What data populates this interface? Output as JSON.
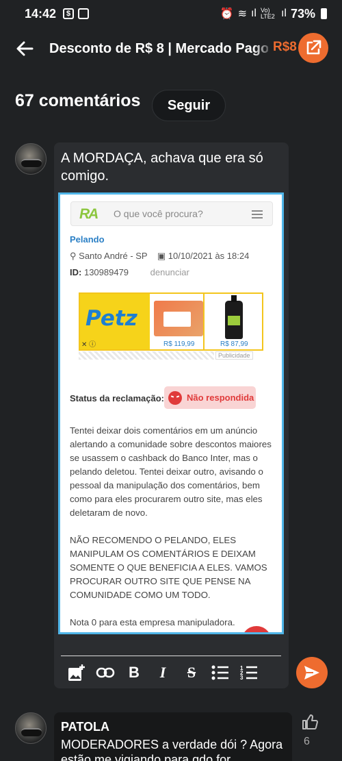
{
  "status_bar": {
    "time": "14:42",
    "network": "Vo) LTE2",
    "battery": "73%"
  },
  "app_bar": {
    "title": "Desconto de R$ 8 | Mercado Pago",
    "price": "R$8"
  },
  "comments_header": {
    "count": "67 comentários",
    "follow_label": "Seguir"
  },
  "compose": {
    "text": "A MORDAÇA, achava que era só comigo."
  },
  "screenshot": {
    "search_placeholder": "O que você procura?",
    "logo": "RA",
    "company": "Pelando",
    "location": "Santo André - SP",
    "datetime": "10/10/2021 às 18:24",
    "id_label": "ID:",
    "id_value": "130989479",
    "report_link": "denunciar",
    "ad": {
      "brand": "Petz",
      "price1": "R$ 119,99",
      "price2": "R$ 87,99",
      "label": "Publicidade"
    },
    "status_label": "Status da reclamação:",
    "status_value": "Não respondida",
    "paragraph1": "Tentei deixar dois comentários em um anúncio alertando a comunidade sobre descontos maiores se usassem o cashback do Banco Inter, mas o pelando deletou. Tentei deixar outro, avisando o pessoal da manipulação dos comentários, bem como para eles procurarem outro site, mas eles deletaram de novo.",
    "paragraph2": "NÃO RECOMENDO O PELANDO, ELES MANIPULAM OS COMENTÁRIOS E DEIXAM SOMENTE O QUE BENEFICIA A ELES. VAMOS PROCURAR OUTRO SITE QUE PENSE NA COMUNIDADE COMO UM TODO.",
    "paragraph3": "Nota 0 para esta empresa manipuladora."
  },
  "comment2": {
    "author": "PATOLA",
    "text": "MODERADORES a verdade dói ? Agora estão me vigiando para qdo for",
    "likes": "6"
  },
  "colors": {
    "accent": "#ee6c2f",
    "background": "#202224",
    "image_border": "#4fb5e8"
  }
}
